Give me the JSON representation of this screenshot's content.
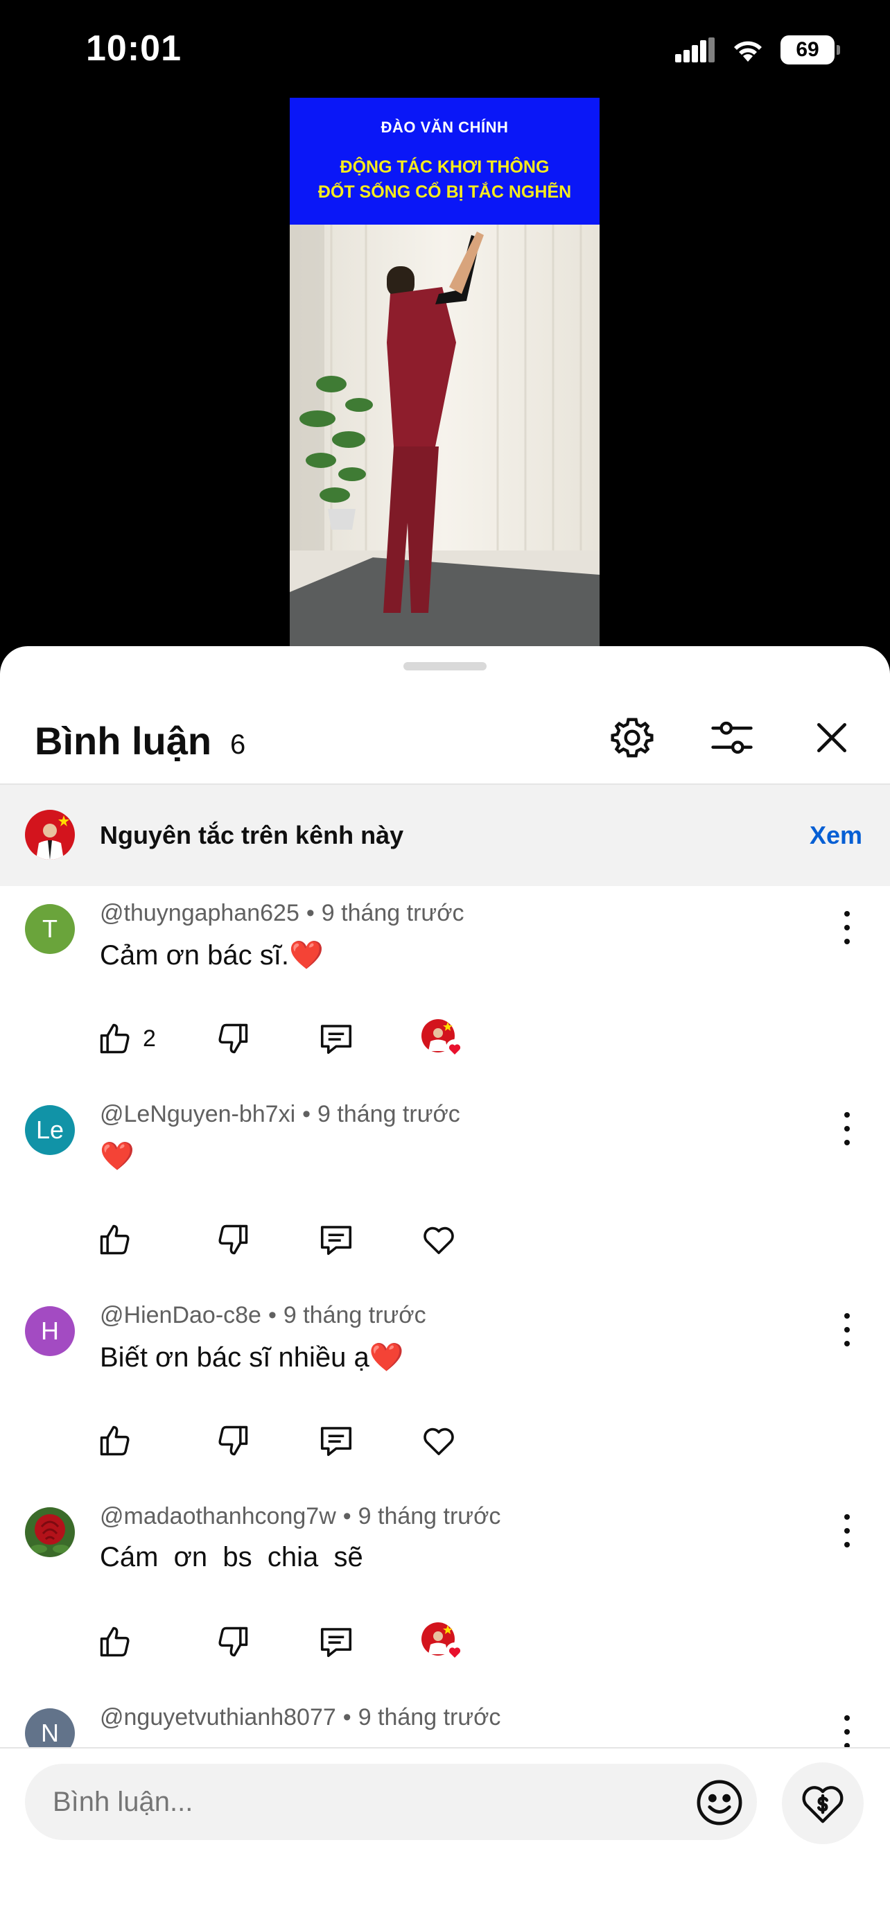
{
  "status_bar": {
    "time": "10:01",
    "battery": "69"
  },
  "video": {
    "channel": "ĐÀO VĂN CHÍNH",
    "title_line1": "ĐỘNG TÁC KHƠI THÔNG",
    "title_line2": "ĐỐT SỐNG CỔ BỊ TẮC NGHẼN"
  },
  "comments_sheet": {
    "title": "Bình luận",
    "count": "6",
    "guidelines": {
      "text": "Nguyên tắc trên kênh này",
      "link": "Xem"
    },
    "comments": [
      {
        "avatar_letter": "T",
        "avatar_color": "#6aa43b",
        "author": "@thuyngaphan625",
        "time": "9 tháng trước",
        "text": "Cảm ơn bác sĩ.",
        "emoji": "❤️",
        "likes": "2",
        "creator_heart": true
      },
      {
        "avatar_letter": "Le",
        "avatar_color": "#1193a7",
        "author": "@LeNguyen-bh7xi",
        "time": "9 tháng trước",
        "text": "",
        "emoji": "❤️",
        "likes": "",
        "creator_heart": false
      },
      {
        "avatar_letter": "H",
        "avatar_color": "#a34bc2",
        "author": "@HienDao-c8e",
        "time": "9 tháng trước",
        "text": "Biết ơn bác sĩ nhiều ạ",
        "emoji": "❤️",
        "likes": "",
        "creator_heart": false
      },
      {
        "avatar_letter": "",
        "avatar_color": "#b3121a",
        "author": "@madaothanhcong7w",
        "time": "9 tháng trước",
        "text": "Cám  ơn  bs  chia  sẽ",
        "emoji": "",
        "likes": "",
        "creator_heart": true
      },
      {
        "avatar_letter": "N",
        "avatar_color": "#62738a",
        "author": "@nguyetvuthianh8077",
        "time": "9 tháng trước",
        "text": "",
        "emoji": "",
        "likes": "",
        "creator_heart": false
      }
    ]
  },
  "composer": {
    "placeholder": "Bình luận..."
  },
  "colors": {
    "accent_link": "#065fd4",
    "video_banner": "#0a17f7",
    "video_title": "#f7ec1d",
    "heart": "#e8112d"
  }
}
